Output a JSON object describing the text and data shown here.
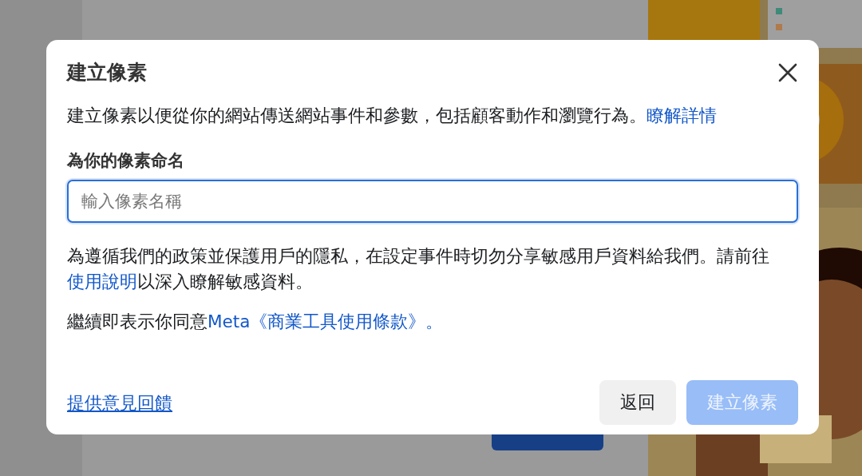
{
  "dialog": {
    "title": "建立像素",
    "description": [
      {
        "kind": "text",
        "text": "建立像素以便從你的網站傳送網站事件和參數，包括顧客動作和瀏覽行為。"
      },
      {
        "kind": "link",
        "text": "瞭解詳情"
      }
    ],
    "field": {
      "label": "為你的像素命名",
      "placeholder": "輸入像素名稱",
      "focused": true
    },
    "notice": [
      {
        "kind": "text",
        "text": "為遵循我們的政策並保護用戶的隱私，在設定事件時切勿分享敏感用戶資料給我們。請前往"
      },
      {
        "kind": "link",
        "text": "使用說明"
      },
      {
        "kind": "text",
        "text": "以深入瞭解敏感資料。"
      }
    ],
    "terms": [
      {
        "kind": "text",
        "text": "繼續即表示你同意"
      },
      {
        "kind": "link",
        "text": "Meta《商業工具使用條款》。"
      }
    ],
    "feedback_link": "提供意見回饋",
    "buttons": [
      {
        "kind": "secondary",
        "label": "返回",
        "disabled": false
      },
      {
        "kind": "primary",
        "label": "建立像素",
        "disabled": true
      }
    ]
  }
}
